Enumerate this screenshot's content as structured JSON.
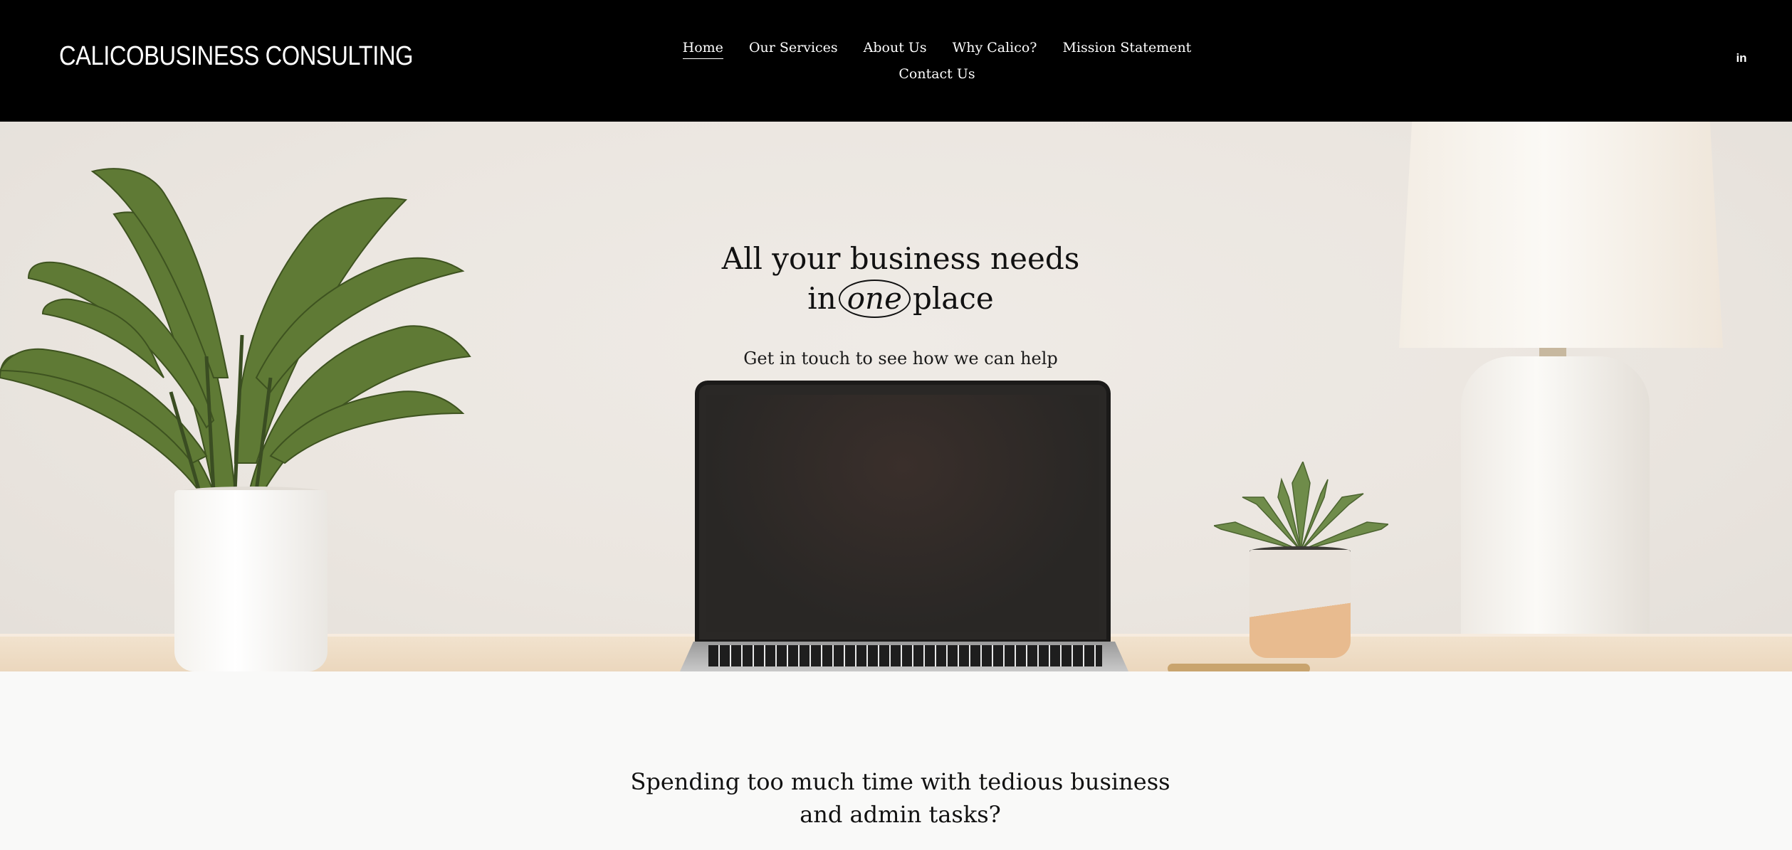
{
  "header": {
    "logo": "CALICOBUSINESS CONSULTING",
    "nav": [
      {
        "label": "Home",
        "active": true
      },
      {
        "label": "Our Services",
        "active": false
      },
      {
        "label": "About Us",
        "active": false
      },
      {
        "label": "Why Calico?",
        "active": false
      },
      {
        "label": "Mission Statement",
        "active": false
      },
      {
        "label": "Contact Us",
        "active": false
      }
    ],
    "social_icon": "linkedin-icon",
    "social_label": "in"
  },
  "hero": {
    "heading_line1": "All your business needs",
    "heading_in": "in",
    "heading_one": "one",
    "heading_place": "place",
    "subheading": "Get in touch to see how we can help"
  },
  "section": {
    "question": "Spending too much time with tedious business and admin tasks?"
  },
  "colors": {
    "header_bg": "#000000",
    "page_bg": "#f9f9f8",
    "text": "#111111"
  }
}
